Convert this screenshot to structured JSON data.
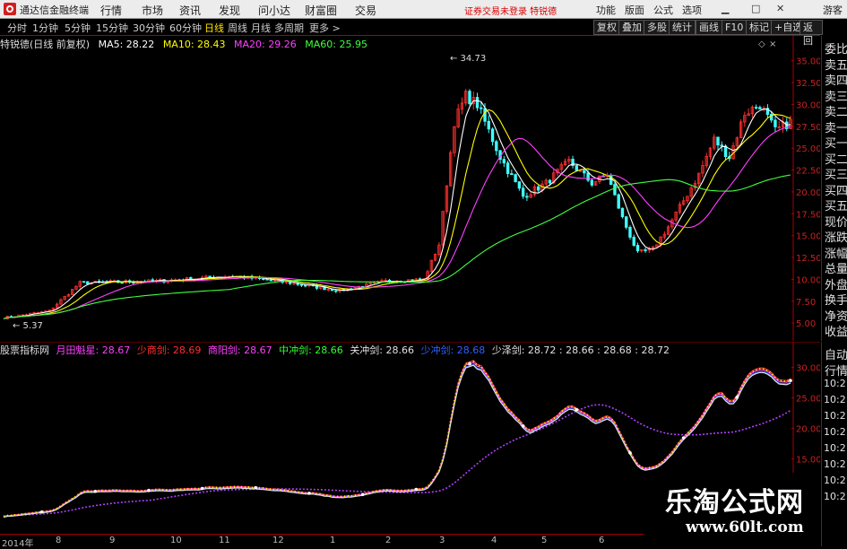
{
  "menubar": {
    "app_title": "通达信金融终端",
    "items": [
      "行情",
      "市场",
      "资讯",
      "发现",
      "问小达",
      "财富圈",
      "交易"
    ],
    "notice": "证券交易未登录  特锐德",
    "right": [
      "功能",
      "版面",
      "公式",
      "选项"
    ],
    "guest": "游客"
  },
  "periods": {
    "tabs": [
      "分时",
      "1分钟",
      "5分钟",
      "15分钟",
      "30分钟",
      "60分钟",
      "日线",
      "周线",
      "月线",
      "多周期",
      "更多 >"
    ],
    "active": "日线"
  },
  "tools": [
    "复权",
    "叠加",
    "多股",
    "统计",
    "画线",
    "F10",
    "标记",
    "+自选",
    "返回"
  ],
  "info": {
    "stock": "特锐德(日线 前复权)",
    "ma5": "MA5: 28.22",
    "ma10": "MA10: 28.43",
    "ma20": "MA20: 29.26",
    "ma60": "MA60: 25.95",
    "high_label": "34.73",
    "low_label": "5.37"
  },
  "price_axis": [
    "35.00",
    "32.50",
    "30.00",
    "27.50",
    "25.00",
    "22.50",
    "20.00",
    "17.50",
    "15.00",
    "12.50",
    "10.00",
    "7.50",
    "5.00"
  ],
  "sub": {
    "name": "股票指标网",
    "items": [
      {
        "text": "月田魁星: 28.67",
        "color": "#ff3fff"
      },
      {
        "text": "少商剑: 28.69",
        "color": "#ff3030"
      },
      {
        "text": "商阳剑: 28.67",
        "color": "#ff40ff"
      },
      {
        "text": "中冲剑: 28.66",
        "color": "#30ff30"
      },
      {
        "text": "关冲剑: 28.66",
        "color": "#e0e0e0"
      },
      {
        "text": "少冲剑: 28.68",
        "color": "#3060ff"
      },
      {
        "text": "少泽剑: 28.72 : 28.66 : 28.68 : 28.72",
        "color": "#e0e0e0"
      }
    ],
    "axis": [
      "30.00",
      "25.00",
      "20.00",
      "15.00"
    ]
  },
  "right_panel": [
    "委比",
    "卖五",
    "卖四",
    "卖三",
    "卖二",
    "卖一",
    "买一",
    "买二",
    "买三",
    "买四",
    "买五",
    "现价",
    "涨跌",
    "涨幅",
    "总量",
    "外盘",
    "换手",
    "净资",
    "收益"
  ],
  "right_panel2": [
    "自动",
    "行情",
    "10:2",
    "10:2",
    "10:2",
    "10:2",
    "10:2",
    "10:2",
    "10:2",
    "10:2"
  ],
  "dates": [
    "2014年",
    "8",
    "9",
    "10",
    "11",
    "12",
    "1",
    "2",
    "3",
    "4",
    "5",
    "6",
    "7",
    "8",
    "9",
    "10"
  ],
  "watermark": {
    "title": "乐淘公式网",
    "url": "www.60lt.com"
  },
  "colors": {
    "ma5": "#ffffff",
    "ma10": "#ffff00",
    "ma20": "#ff40ff",
    "ma60": "#40ff40",
    "up": "#ff3030",
    "down": "#40ffff"
  },
  "chart_data": {
    "type": "line",
    "series": [
      {
        "name": "MA60",
        "values": [
          5.5,
          6,
          6.5,
          7,
          7.5,
          8,
          8.5,
          9,
          9.3,
          9.5,
          9.6,
          9.7,
          10,
          13,
          17,
          20,
          22,
          23,
          24,
          24.5,
          24,
          22,
          21,
          21,
          22,
          23,
          24,
          25.5
        ]
      }
    ],
    "ylim": [
      4.5,
      36
    ]
  }
}
